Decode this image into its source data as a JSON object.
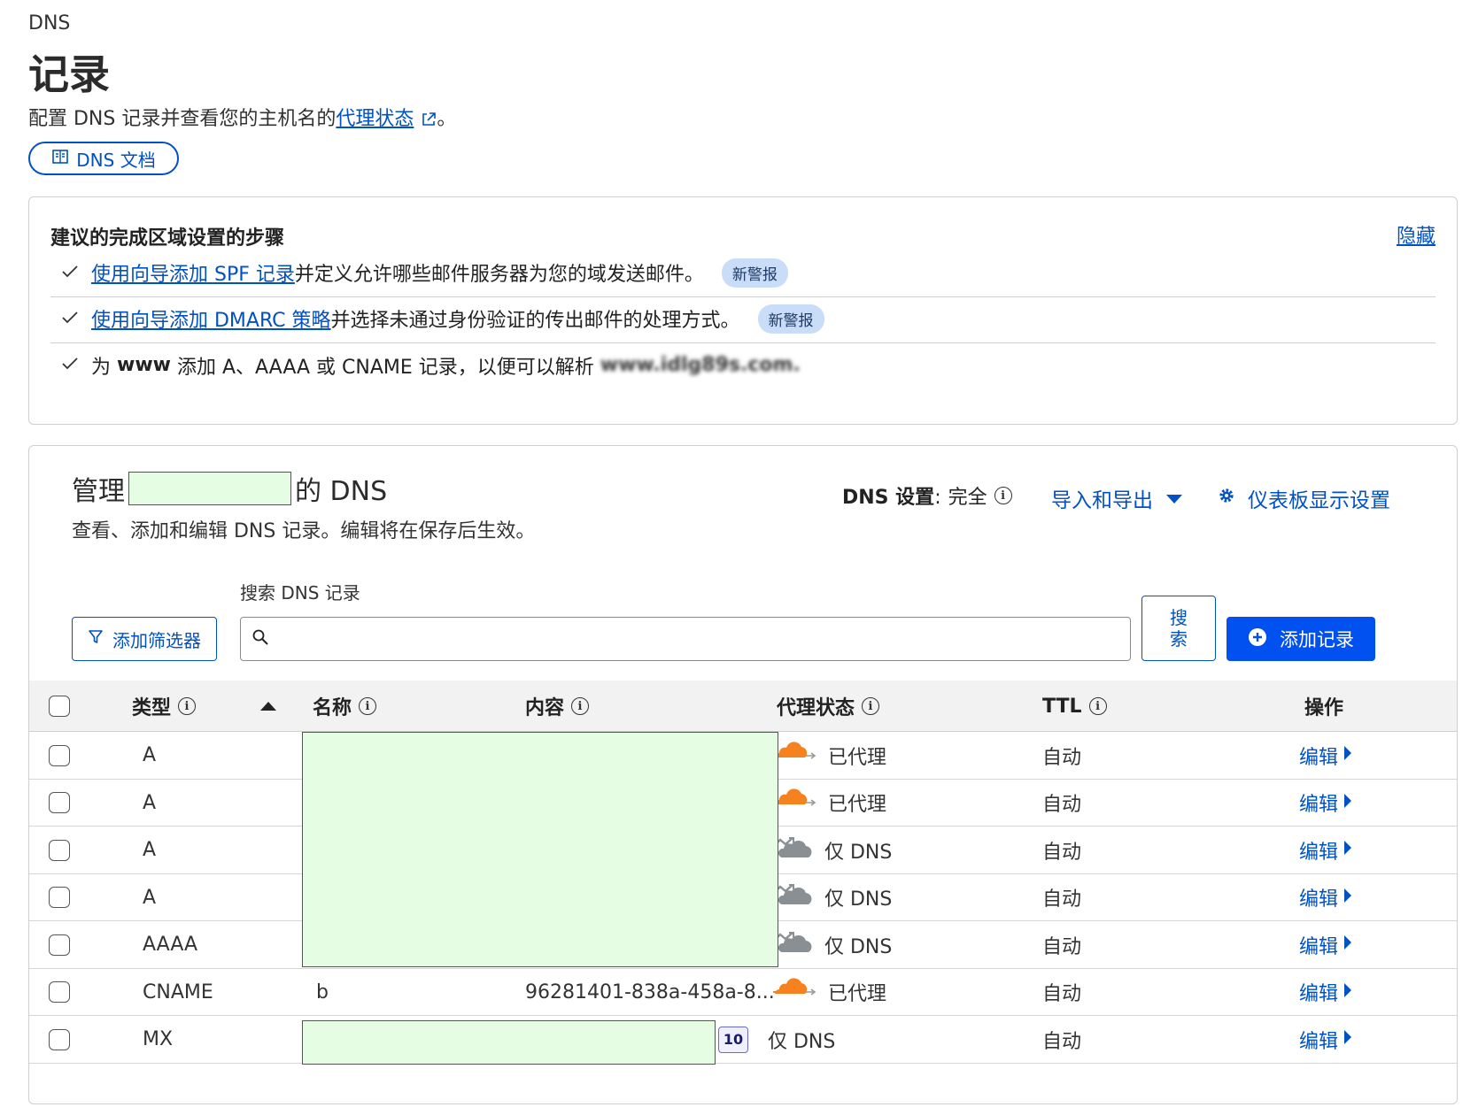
{
  "header": {
    "breadcrumb": "DNS",
    "title": "记录",
    "desc_prefix": "配置 DNS 记录并查看您的主机名的",
    "desc_link": "代理状态",
    "desc_suffix": "。",
    "docs_button": "DNS 文档"
  },
  "steps": {
    "title": "建议的完成区域设置的步骤",
    "hide_label": "隐藏",
    "items": [
      {
        "link": "使用向导添加 SPF 记录",
        "text": "并定义允许哪些邮件服务器为您的域发送邮件。",
        "badge": "新警报"
      },
      {
        "link": "使用向导添加 DMARC 策略",
        "text": "并选择未通过身份验证的传出邮件的处理方式。",
        "badge": "新警报"
      },
      {
        "pre": "为 ",
        "bold": "www",
        "text": " 添加 A、AAAA 或 CNAME 记录，以便可以解析 ",
        "blurred": "www.idlg89s.com."
      }
    ]
  },
  "dns": {
    "title_prefix": "管理",
    "title_suffix": "的 DNS",
    "subtitle": "查看、添加和编辑 DNS 记录。编辑将在保存后生效。",
    "settings_label": "DNS 设置",
    "settings_sep": ":",
    "settings_value": "完全",
    "import_export": "导入和导出",
    "dashboard_settings": "仪表板显示设置",
    "search_label": "搜索 DNS 记录",
    "search_placeholder": "",
    "filter_button": "添加筛选器",
    "search_button": "搜索",
    "add_button": "添加记录"
  },
  "table": {
    "headers": {
      "type": "类型",
      "name": "名称",
      "content": "内容",
      "proxy": "代理状态",
      "ttl": "TTL",
      "actions": "操作"
    },
    "rows": [
      {
        "type": "A",
        "name": "",
        "content": "",
        "proxy": "已代理",
        "proxied": true,
        "ttl": "自动",
        "action": "编辑"
      },
      {
        "type": "A",
        "name": "",
        "content": "",
        "proxy": "已代理",
        "proxied": true,
        "ttl": "自动",
        "action": "编辑"
      },
      {
        "type": "A",
        "name": "",
        "content": "",
        "proxy": "仅 DNS",
        "proxied": false,
        "ttl": "自动",
        "action": "编辑"
      },
      {
        "type": "A",
        "name": "",
        "content": "",
        "proxy": "仅 DNS",
        "proxied": false,
        "ttl": "自动",
        "action": "编辑"
      },
      {
        "type": "AAAA",
        "name": "",
        "content": "",
        "proxy": "仅 DNS",
        "proxied": false,
        "ttl": "自动",
        "action": "编辑"
      },
      {
        "type": "CNAME",
        "name": "b",
        "content": "96281401-838a-458a-8...",
        "proxy": "已代理",
        "proxied": true,
        "ttl": "自动",
        "action": "编辑"
      },
      {
        "type": "MX",
        "name": "",
        "content": "",
        "priority": "10",
        "proxy": "仅 DNS",
        "proxied": false,
        "ttl": "自动",
        "action": "编辑"
      }
    ]
  },
  "colors": {
    "accent": "#0051c3",
    "primary_button": "#0051f0",
    "proxied_cloud": "#f6821f",
    "dns_only_cloud": "#8a8f94",
    "redaction": "#e4fde3"
  }
}
